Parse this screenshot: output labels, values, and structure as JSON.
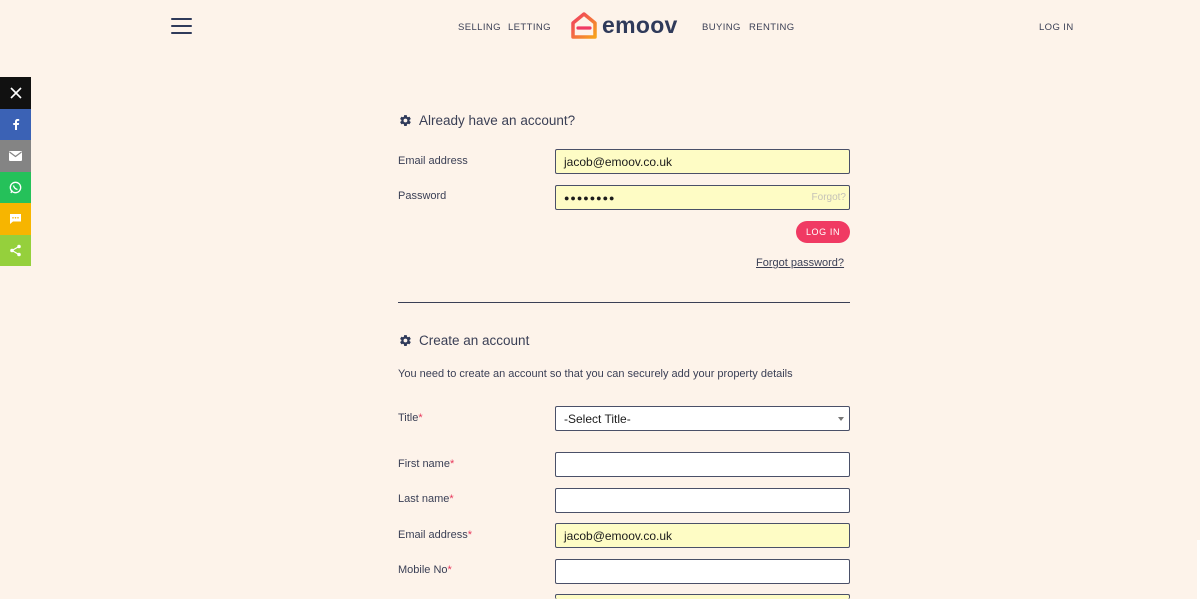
{
  "header": {
    "nav_left": [
      "SELLING",
      "LETTING"
    ],
    "nav_right": [
      "BUYING",
      "RENTING"
    ],
    "logo_text": "emoov",
    "login_label": "LOG IN"
  },
  "share": [
    {
      "icon": "x-twitter-icon",
      "color": "#111111"
    },
    {
      "icon": "facebook-icon",
      "color": "#3b62b5"
    },
    {
      "icon": "email-icon",
      "color": "#848484"
    },
    {
      "icon": "whatsapp-icon",
      "color": "#25c15a"
    },
    {
      "icon": "sms-icon",
      "color": "#f7b500"
    },
    {
      "icon": "share-icon",
      "color": "#95d03c"
    }
  ],
  "login_section": {
    "title": "Already have an account?",
    "email_label": "Email address",
    "email_value": "jacob@emoov.co.uk",
    "password_label": "Password",
    "password_value": "●●●●●●●●",
    "forgot_inline": "Forgot?",
    "login_button": "LOG IN",
    "forgot_link": "Forgot password?"
  },
  "create_section": {
    "title": "Create an account",
    "description": "You need to create an account so that you can securely add your property details",
    "title_label": "Title",
    "title_select": "-Select Title-",
    "first_name_label": "First name",
    "first_name_value": "",
    "last_name_label": "Last name",
    "last_name_value": "",
    "email_label": "Email address",
    "email_value": "jacob@emoov.co.uk",
    "mobile_label": "Mobile No",
    "mobile_value": "",
    "required_mark": "*"
  },
  "colors": {
    "background": "#fdf3ea",
    "accent": "#f03a63",
    "autofill": "#fefcc5"
  }
}
